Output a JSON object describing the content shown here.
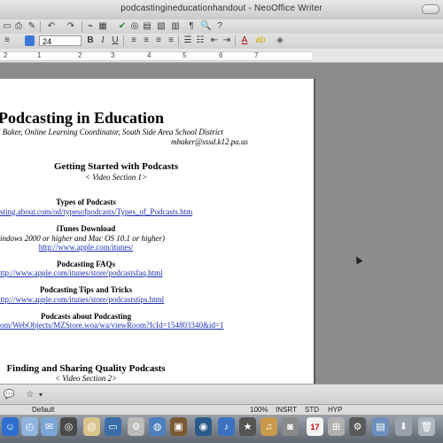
{
  "window": {
    "title": "podcastingineducationhandout - NeoOffice Writer"
  },
  "toolbar": {
    "font_size": "24"
  },
  "ruler": {
    "numbers": [
      "2",
      "1",
      "2",
      "3",
      "4",
      "5",
      "6",
      "7"
    ]
  },
  "document": {
    "title": "Podcasting in Education",
    "byline_line1": "l Baker, Online Learning Coordinator, South Side Area School District",
    "byline_line2": "mbaker@sssd.k12.pa.us",
    "section1_heading": "Getting Started with Podcasts",
    "section1_sub": "< Video Section 1>",
    "types_heading": "Types of Podcasts",
    "types_link": "sting.about.com/od/typesofpodcasts/Types_of_Podcasts.htm",
    "itunes_heading": "iTunes Download",
    "itunes_note": "indows 2000 or higher and Mac OS 10.1 or higher)",
    "itunes_link": "http://www.apple.com/itunes/",
    "faq_heading": "Podcasting FAQs",
    "faq_link": "http://www.apple.com/itunes/store/podcastsfaq.html",
    "tips_heading": "Podcasting Tips and Tricks",
    "tips_link": "http://www.apple.com/itunes/store/podcaststips.html",
    "about_heading": "Podcasts about Podcasting",
    "about_link": "om/WebObjects/MZStore.woa/wa/viewRoom?fcId=154803340&id=1",
    "section2_heading": "Finding and Sharing Quality Podcasts",
    "section2_sub": "< Video Section 2>"
  },
  "status": {
    "page_style": "Default",
    "zoom": "100%",
    "insert_mode": "INSRT",
    "selection_mode": "STD",
    "hyphenation": "HYP"
  },
  "dock": {
    "calendar_day": "17"
  },
  "colors": {
    "link": "#1a2eb5",
    "page_bg": "#ffffff",
    "canvas_bg": "#8c8c8c"
  }
}
